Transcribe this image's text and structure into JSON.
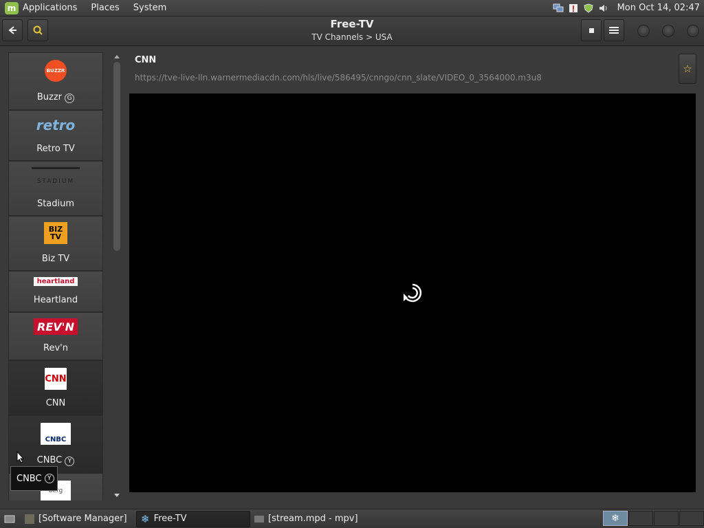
{
  "top_panel": {
    "menu": [
      "Applications",
      "Places",
      "System"
    ],
    "clock": "Mon Oct 14, 02:47"
  },
  "header": {
    "title": "Free-TV",
    "subtitle": "TV Channels > USA"
  },
  "channels": [
    {
      "label": "Buzzr",
      "badge": "G",
      "logo_text": "BUZZR"
    },
    {
      "label": "Retro TV",
      "badge": "",
      "logo_text": "retro"
    },
    {
      "label": "Stadium",
      "badge": "",
      "logo_text": "STADIUM"
    },
    {
      "label": "Biz TV",
      "badge": "",
      "logo_text": "BIZ TV"
    },
    {
      "label": "Heartland",
      "badge": "",
      "logo_text": "heartland"
    },
    {
      "label": "Rev'n",
      "badge": "",
      "logo_text": "REV'N"
    },
    {
      "label": "CNN",
      "badge": "",
      "logo_text": "CNN"
    },
    {
      "label": "CNBC",
      "badge": "Y",
      "logo_text": "CNBC"
    },
    {
      "label": "",
      "badge": "",
      "logo_text": "berg"
    }
  ],
  "main": {
    "channel_name": "CNN",
    "stream_url": "https://tve-live-lln.warnermediacdn.com/hls/live/586495/cnngo/cnn_slate/VIDEO_0_3564000.m3u8"
  },
  "tooltip": {
    "text": "CNBC",
    "badge": "Y"
  },
  "taskbar": {
    "tasks": [
      "[Software Manager]",
      "Free-TV",
      "[stream.mpd - mpv]"
    ]
  },
  "colors": {
    "accent_star": "#e9c73a",
    "buzzr_orange": "#f04e23",
    "revn_red": "#c8102e",
    "cnn_red": "#cc0000"
  }
}
